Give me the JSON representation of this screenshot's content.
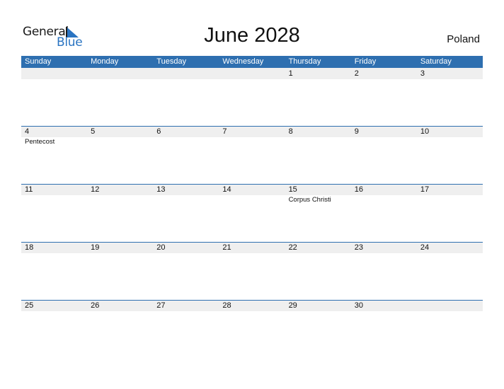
{
  "logo": {
    "part1": "General",
    "part2": "Blue"
  },
  "title": "June 2028",
  "country": "Poland",
  "colors": {
    "header_bg": "#2e6fb0",
    "date_strip_bg": "#efefef",
    "logo_blue": "#2a74c2"
  },
  "weekdays": [
    "Sunday",
    "Monday",
    "Tuesday",
    "Wednesday",
    "Thursday",
    "Friday",
    "Saturday"
  ],
  "weeks": [
    {
      "days": [
        "",
        "",
        "",
        "",
        "1",
        "2",
        "3"
      ],
      "events": [
        "",
        "",
        "",
        "",
        "",
        "",
        ""
      ]
    },
    {
      "days": [
        "4",
        "5",
        "6",
        "7",
        "8",
        "9",
        "10"
      ],
      "events": [
        "Pentecost",
        "",
        "",
        "",
        "",
        "",
        ""
      ]
    },
    {
      "days": [
        "11",
        "12",
        "13",
        "14",
        "15",
        "16",
        "17"
      ],
      "events": [
        "",
        "",
        "",
        "",
        "Corpus Christi",
        "",
        ""
      ]
    },
    {
      "days": [
        "18",
        "19",
        "20",
        "21",
        "22",
        "23",
        "24"
      ],
      "events": [
        "",
        "",
        "",
        "",
        "",
        "",
        ""
      ]
    },
    {
      "days": [
        "25",
        "26",
        "27",
        "28",
        "29",
        "30",
        ""
      ],
      "events": [
        "",
        "",
        "",
        "",
        "",
        "",
        ""
      ]
    }
  ]
}
